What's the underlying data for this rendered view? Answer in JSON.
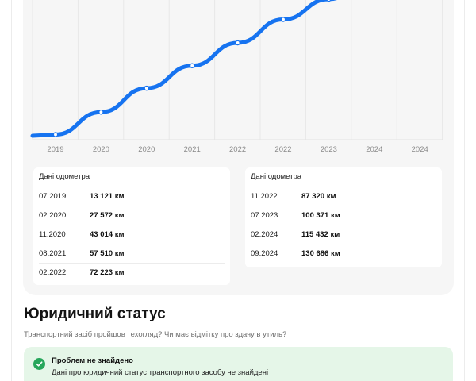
{
  "chart_data": {
    "type": "line",
    "x": [
      "07.2019",
      "02.2020",
      "11.2020",
      "08.2021",
      "02.2022",
      "11.2022",
      "07.2023",
      "02.2024",
      "09.2024"
    ],
    "tick_labels": [
      "2019",
      "2020",
      "2020",
      "2021",
      "2022",
      "2022",
      "2023",
      "2024",
      "2024"
    ],
    "series": [
      {
        "values": [
          13121,
          27572,
          43014,
          57510,
          72223,
          87320,
          100371,
          115432,
          130686
        ]
      }
    ],
    "ylim": [
      11000,
      103000
    ],
    "color": "#1673f0",
    "grid": true
  },
  "odometer": {
    "left": {
      "title": "Дані одометра",
      "rows": [
        {
          "date": "07.2019",
          "value": "13 121 км"
        },
        {
          "date": "02.2020",
          "value": "27 572 км"
        },
        {
          "date": "11.2020",
          "value": "43 014 км"
        },
        {
          "date": "08.2021",
          "value": "57 510 км"
        },
        {
          "date": "02.2022",
          "value": "72 223 км"
        }
      ]
    },
    "right": {
      "title": "Дані одометра",
      "rows": [
        {
          "date": "11.2022",
          "value": "87 320 км"
        },
        {
          "date": "07.2023",
          "value": "100 371 км"
        },
        {
          "date": "02.2024",
          "value": "115 432 км"
        },
        {
          "date": "09.2024",
          "value": "130 686 км"
        }
      ]
    }
  },
  "legal": {
    "title": "Юридичний статус",
    "subtitle": "Транспортний засіб пройшов техогляд? Чи має відмітку про здачу в утиль?",
    "status_title": "Проблем не знайдено",
    "status_text": "Дані про юридичний статус транспортного засобу не знайдені",
    "status_icon": "check-circle-icon"
  }
}
